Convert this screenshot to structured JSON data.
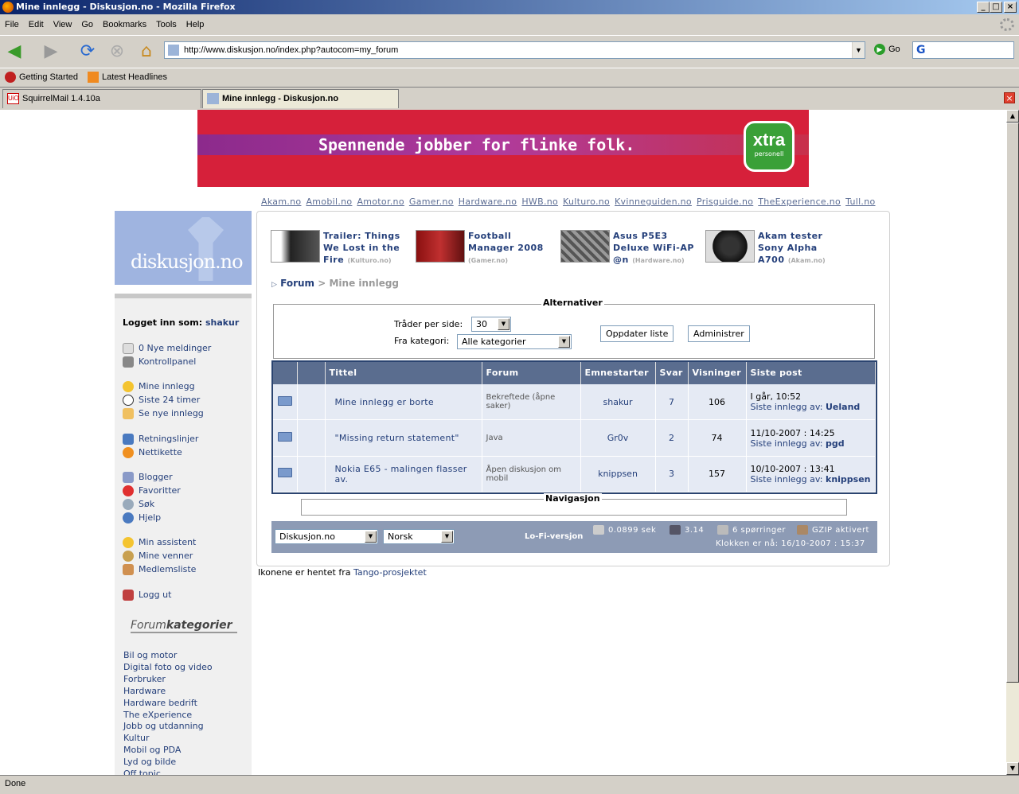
{
  "window": {
    "title": "Mine innlegg - Diskusjon.no - Mozilla Firefox"
  },
  "menu": [
    "File",
    "Edit",
    "View",
    "Go",
    "Bookmarks",
    "Tools",
    "Help"
  ],
  "toolbar": {
    "url": "http://www.diskusjon.no/index.php?autocom=my_forum",
    "go_label": "Go"
  },
  "bookmarks": [
    "Getting Started",
    "Latest Headlines"
  ],
  "tabs": [
    {
      "label": "SquirrelMail 1.4.10a"
    },
    {
      "label": "Mine innlegg - Diskusjon.no"
    }
  ],
  "status": "Done",
  "banner": {
    "text": "Spennende jobber for flinke folk.",
    "logo": "xtra",
    "logo_sub": "personell"
  },
  "toplinks": [
    "Akam.no",
    "Amobil.no",
    "Amotor.no",
    "Gamer.no",
    "Hardware.no",
    "HWB.no",
    "Kulturo.no",
    "Kvinneguiden.no",
    "Prisguide.no",
    "TheExperience.no",
    "Tull.no"
  ],
  "logo_text": "diskusjon.no",
  "sidebar": {
    "login_label": "Logget inn som:",
    "user": "shakur",
    "links": [
      "0 Nye meldinger",
      "Kontrollpanel",
      "Mine innlegg",
      "Siste 24 timer",
      "Se nye innlegg",
      "Retningslinjer",
      "Nettikette",
      "Blogger",
      "Favoritter",
      "Søk",
      "Hjelp",
      "Min assistent",
      "Mine venner",
      "Medlemsliste",
      "Logg ut"
    ],
    "cat_head_a": "Forum",
    "cat_head_b": "kategorier",
    "categories": [
      "Bil og motor",
      "Digital foto og video",
      "Forbruker",
      "Hardware",
      "Hardware bedrift",
      "The eXperience",
      "Jobb og utdanning",
      "Kultur",
      "Mobil og PDA",
      "Lyd og bilde",
      "Off topic"
    ]
  },
  "promos": [
    {
      "title": "Trailer: Things We Lost in the Fire",
      "source": "(Kulturo.no)"
    },
    {
      "title": "Football Manager 2008",
      "source": "(Gamer.no)"
    },
    {
      "title": "Asus P5E3 Deluxe WiFi-AP @n",
      "source": "(Hardware.no)"
    },
    {
      "title": "Akam tester Sony Alpha A700",
      "source": "(Akam.no)"
    }
  ],
  "breadcrumb": {
    "forum": "Forum",
    "sep": ">",
    "current": "Mine innlegg"
  },
  "alternatives": {
    "legend": "Alternativer",
    "per_page_label": "Tråder per side:",
    "per_page_value": "30",
    "category_label": "Fra kategori:",
    "category_value": "Alle kategorier",
    "update_btn": "Oppdater liste",
    "admin_btn": "Administrer"
  },
  "table": {
    "headers": [
      "",
      "",
      "Tittel",
      "Forum",
      "Emnestarter",
      "Svar",
      "Visninger",
      "Siste post"
    ],
    "rows": [
      {
        "title": "Mine innlegg er borte",
        "forum": "Bekreftede (åpne saker)",
        "starter": "shakur",
        "replies": "7",
        "views": "106",
        "last_time": "I går, 10:52",
        "last_label": "Siste innlegg av:",
        "last_user": "Ueland"
      },
      {
        "title": "\"Missing return statement\"",
        "forum": "Java",
        "starter": "Gr0v",
        "replies": "2",
        "views": "74",
        "last_time": "11/10-2007 : 14:25",
        "last_label": "Siste innlegg av:",
        "last_user": "pgd"
      },
      {
        "title": "Nokia E65 - malingen flasser av.",
        "forum": "Åpen diskusjon om mobil",
        "starter": "knippsen",
        "replies": "3",
        "views": "157",
        "last_time": "10/10-2007 : 13:41",
        "last_label": "Siste innlegg av:",
        "last_user": "knippsen"
      }
    ]
  },
  "navigation_legend": "Navigasjon",
  "footer": {
    "site_select": "Diskusjon.no",
    "lang_select": "Norsk",
    "lofi": "Lo-Fi-versjon",
    "time": "0.0899 sek",
    "load": "3.14",
    "queries": "6 spørringer",
    "gzip": "GZIP aktivert",
    "clock": "Klokken er nå: 16/10-2007 : 15:37"
  },
  "credit": {
    "text": "Ikonene er hentet fra",
    "link": "Tango-prosjektet"
  },
  "colors": {
    "header_bg": "#5a6d8f",
    "row_bg": "#e5eaf4",
    "link": "#243f7a",
    "logo_bg": "#9fb4e0"
  }
}
